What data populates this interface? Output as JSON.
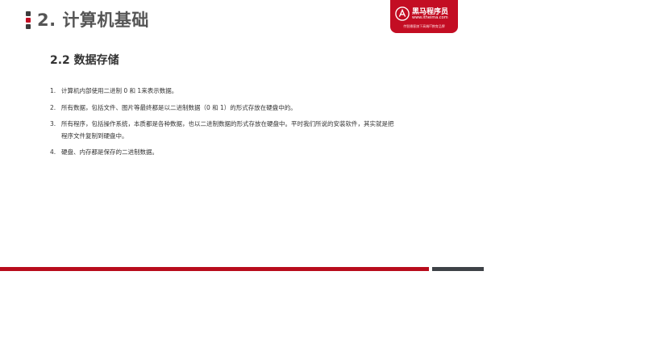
{
  "header": {
    "chapter_title": "2. 计算机基础"
  },
  "logo": {
    "brand_name": "黑马程序员",
    "brand_url": "www.itheima.com",
    "slogan": "传智播客旗下高端IT教育品牌",
    "colors": {
      "background": "#c30d23",
      "text": "#ffffff"
    }
  },
  "section": {
    "title": "2.2 数据存储"
  },
  "points": [
    {
      "num": "1.",
      "text": "计算机内部使用二进制 0 和 1来表示数据。"
    },
    {
      "num": "2.",
      "text": "所有数据，包括文件、图片等最终都是以二进制数据（0 和 1）的形式存放在硬盘中的。"
    },
    {
      "num": "3.",
      "text": "所有程序，包括操作系统，本质都是各种数据，也以二进制数据的形式存放在硬盘中。平时我们所说的安装软件，其实就是把程序文件复制到硬盘中。"
    },
    {
      "num": "4.",
      "text": "硬盘、内存都是保存的二进制数据。"
    }
  ],
  "theme": {
    "accent": "#c30d23",
    "dark": "#3e4247",
    "title_text": "#555555"
  }
}
